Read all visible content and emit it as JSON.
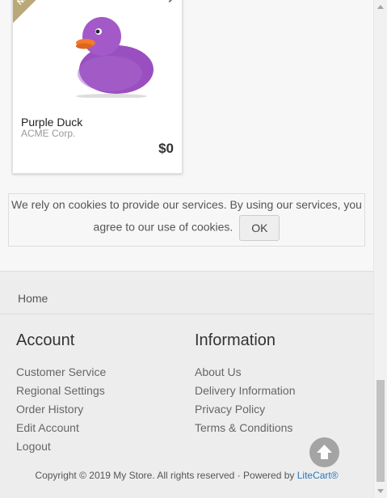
{
  "product": {
    "ribbon": "New",
    "name": "Purple Duck",
    "manufacturer": "ACME Corp.",
    "price": "$0"
  },
  "cookie_notice": {
    "line1": "We rely on cookies to provide our services. By using our services, you",
    "line2": "agree to our use of cookies.",
    "ok_label": "OK"
  },
  "footer": {
    "breadcrumb": "Home",
    "account": {
      "title": "Account",
      "links": [
        "Customer Service",
        "Regional Settings",
        "Order History",
        "Edit Account",
        "Logout"
      ]
    },
    "information": {
      "title": "Information",
      "links": [
        "About Us",
        "Delivery Information",
        "Privacy Policy",
        "Terms & Conditions"
      ]
    },
    "copyright_prefix": "Copyright © 2019 My Store. All rights reserved · Powered by ",
    "copyright_brand": "LiteCart®"
  },
  "colors": {
    "accent": "#2a77b8",
    "ribbon": "#b9a978",
    "duck": "#9a4fc0"
  }
}
